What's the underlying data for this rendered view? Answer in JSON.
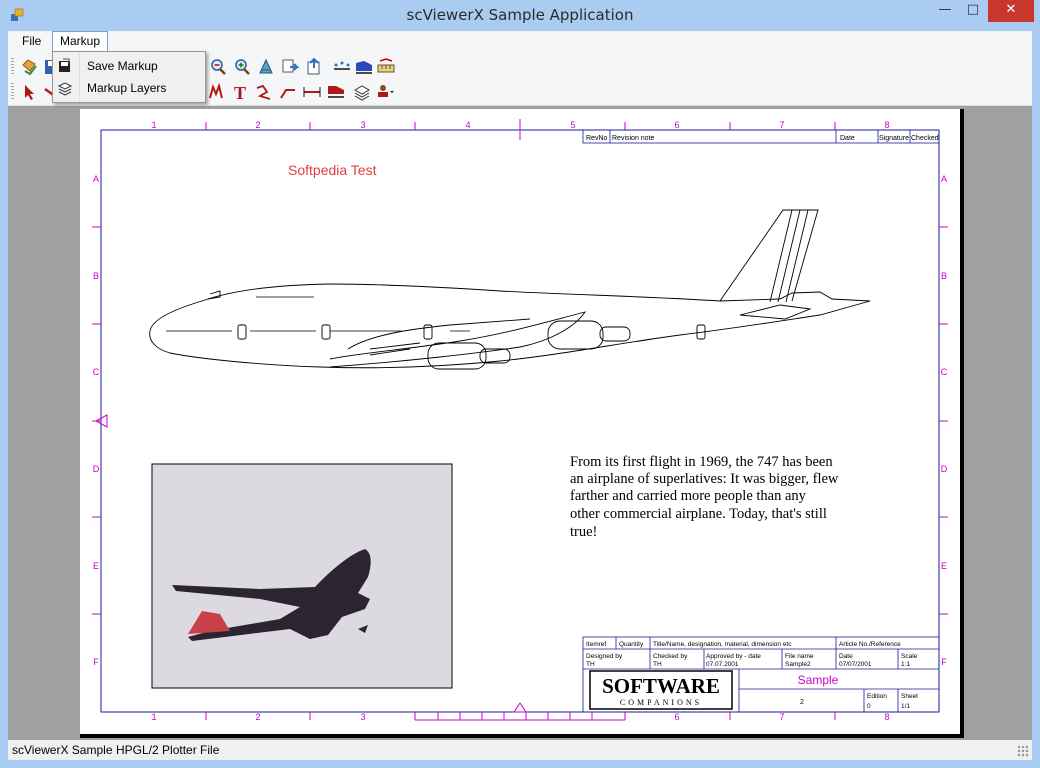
{
  "window": {
    "title": "scViewerX Sample Application",
    "controls": {
      "minimize": "—",
      "maximize": "□",
      "close": "✕"
    }
  },
  "menubar": {
    "items": [
      {
        "label": "File"
      },
      {
        "label": "Markup"
      }
    ]
  },
  "markup_menu": {
    "items": [
      {
        "label": "Save Markup",
        "icon": "save-markup-icon"
      },
      {
        "label": "Markup Layers",
        "icon": "layers-icon"
      }
    ]
  },
  "toolbar1": {
    "icons": [
      "open-icon",
      "save-icon",
      "zoom-out-icon",
      "zoom-in-icon",
      "rotate-icon",
      "print-icon",
      "export-icon",
      "measure-points-icon",
      "fill-area-icon",
      "dimension-icon"
    ]
  },
  "toolbar2": {
    "icons": [
      "select-arrow-icon",
      "erase-icon",
      "markup-pen-icon",
      "text-tool-icon",
      "freehand-icon",
      "line-tool-icon",
      "measure-tool-icon",
      "area-tool-icon",
      "layers-tool-icon",
      "stamp-dropdown-icon"
    ]
  },
  "drawing": {
    "markup_text": "Softpedia Test",
    "body_text_lines": [
      "From its first flight in 1969, the 747 has been",
      "an airplane of superlatives: It was bigger, flew",
      "farther and carried more people than any",
      "other commercial airplane. Today, that's still",
      "true!"
    ],
    "col_numbers": [
      "1",
      "2",
      "3",
      "4",
      "5",
      "6",
      "7",
      "8"
    ],
    "row_letters": [
      "A",
      "B",
      "C",
      "D",
      "E",
      "F"
    ],
    "revision_header": [
      "RevNo",
      "Revision note",
      "Date",
      "Signature",
      "Checked"
    ],
    "title_block": {
      "row1": [
        "Itemref",
        "Quantity",
        "Title/Name, designation, material, dimension etc",
        "Article No./Reference"
      ],
      "designed_by": {
        "label": "Designed by",
        "value": "TH"
      },
      "checked_by": {
        "label": "Checked by",
        "value": "TH"
      },
      "approved_by": {
        "label": "Approved by - date",
        "value": "07.07.2001"
      },
      "file_name": {
        "label": "File name",
        "value": "Sample2"
      },
      "date": {
        "label": "Date",
        "value": "07/07/2001"
      },
      "scale": {
        "label": "Scale",
        "value": "1:1"
      },
      "logo_main": "SOFTWARE",
      "logo_sub": "COMPANIONS",
      "doc_title": "Sample",
      "doc_number": "2",
      "edition": {
        "label": "Edition",
        "value": "0"
      },
      "sheet": {
        "label": "Sheet",
        "value": "1/1"
      }
    }
  },
  "statusbar": {
    "app": "scViewerX Sample",
    "file_type": "HPGL/2 Plotter File"
  },
  "colors": {
    "markup": "#e04040",
    "grid": "#cc00cc",
    "border_blue": "#1a1aa0",
    "close_red": "#c7372c"
  }
}
